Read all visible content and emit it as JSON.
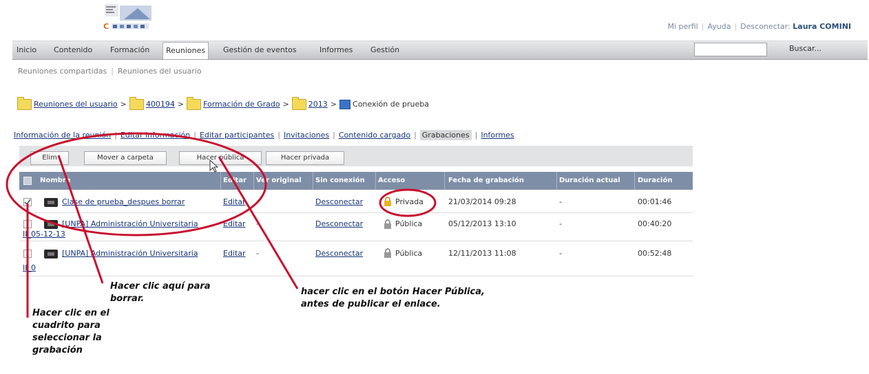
{
  "header": {
    "links": [
      "Mi perfil",
      "Ayuda",
      "Desconectar:"
    ],
    "user": "Laura COMINI"
  },
  "nav": {
    "items": [
      "Inicio",
      "Contenido",
      "Formación",
      "Reuniones",
      "Gestión de eventos",
      "Informes",
      "Gestión"
    ],
    "active": "Reuniones",
    "search_label": "Buscar..."
  },
  "subnav": [
    "Reuniones compartidas",
    "Reuniones del usuario"
  ],
  "breadcrumb": [
    "Reuniones del usuario",
    "400194",
    "Formación de Grado",
    "2013",
    "Conexión de prueba"
  ],
  "tabs": [
    "Información de la reunión",
    "Editar información",
    "Editar participantes",
    "Invitaciones",
    "Contenido cargado",
    "Grabaciones",
    "Informes"
  ],
  "active_tab": "Grabaciones",
  "toolbar": {
    "delete": "Elim",
    "move": "Mover a carpeta",
    "make_public": "Hacer pública",
    "make_private": "Hacer privada"
  },
  "table": {
    "headers": [
      "Nombre",
      "Editar",
      "Ver original",
      "Sin conexión",
      "Acceso",
      "Fecha de grabación",
      "Duración actual",
      "Duración"
    ],
    "rows": [
      {
        "name": "Clase de prueba_despues borrar",
        "name2": "",
        "edit": "Editar",
        "original": "",
        "offline": "Desconectar",
        "access": "Privada",
        "date": "21/03/2014 09:28",
        "actual": "-",
        "duration": "00:01:46",
        "checked": true
      },
      {
        "name": "[UNPA] Administración Universitaria",
        "name2": "II_05-12-13",
        "edit": "Editar",
        "original": "-",
        "offline": "Desconectar",
        "access": "Pública",
        "date": "05/12/2013 13:10",
        "actual": "-",
        "duration": "00:40:20",
        "checked": false
      },
      {
        "name": "[UNPA] Administración Universitaria",
        "name2": "II_0",
        "edit": "Editar",
        "original": "-",
        "offline": "Desconectar",
        "access": "Pública",
        "date": "12/11/2013 11:08",
        "actual": "-",
        "duration": "00:52:48",
        "checked": false
      }
    ]
  },
  "annotations": {
    "delete_note": [
      "Hacer clic aquí para",
      "borrar."
    ],
    "public_note": [
      "hacer clic en el botón Hacer Pública,",
      "antes de publicar el enlace."
    ],
    "checkbox_note": [
      "Hacer clic en el",
      "cuadrito para",
      "seleccionar la",
      "grabación"
    ]
  },
  "colors": {
    "table_header": "#7f8ea7",
    "annotation_red": "#c8102e",
    "link": "#16347a",
    "folder": "#f5da5a"
  }
}
